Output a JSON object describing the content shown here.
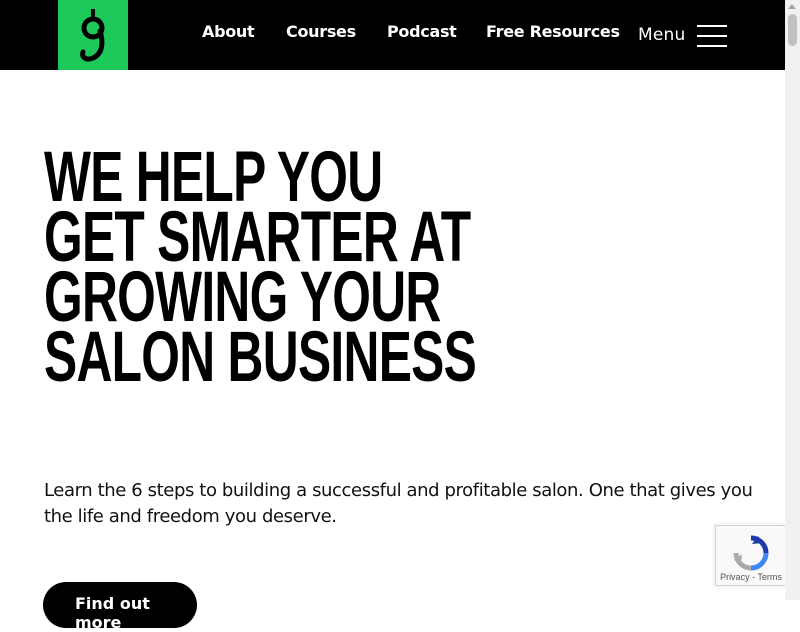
{
  "header": {
    "logo_letter": "g",
    "nav": [
      {
        "label": "About",
        "underline_color": "#ffffff"
      },
      {
        "label": "Courses",
        "underline_color": "#e040b8"
      },
      {
        "label": "Podcast",
        "underline_color": "#f7c81e"
      },
      {
        "label": "Free Resources",
        "underline_color": "#1dc85a"
      }
    ],
    "menu_label": "Menu"
  },
  "hero": {
    "title_lines": [
      "WE HELP YOU",
      "GET SMARTER AT",
      "GROWING YOUR",
      "SALON BUSINESS"
    ],
    "text": "Learn the 6 steps to building a successful and profitable salon. One that gives you the life and freedom you deserve.",
    "cta_label": "Find out more"
  },
  "recaptcha": {
    "privacy": "Privacy",
    "separator": " - ",
    "terms": "Terms"
  },
  "colors": {
    "header_bg": "#000000",
    "logo_bg": "#1dc85a"
  },
  "icons": {
    "logo": "g-logo-icon",
    "menu": "hamburger-menu-icon",
    "recaptcha": "recaptcha-icon"
  }
}
